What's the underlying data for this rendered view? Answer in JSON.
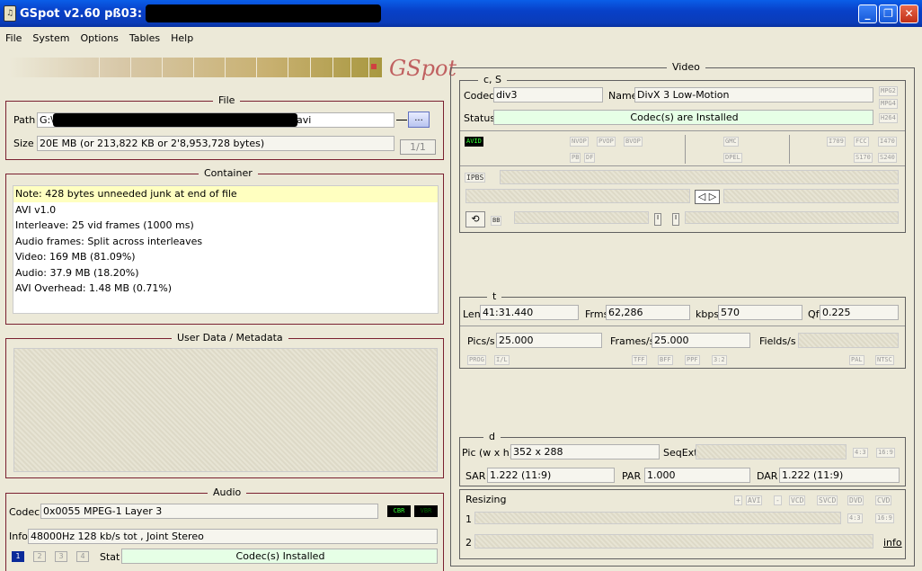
{
  "window": {
    "title": "GSpot v2.60 pß03:"
  },
  "menu": [
    "File",
    "System",
    "Options",
    "Tables",
    "Help"
  ],
  "logo": "GSpot",
  "file": {
    "title": "File",
    "path_label": "Path",
    "path_prefix": "G:\\",
    "path_suffix": "avi",
    "browse_label": "...",
    "size_label": "Size",
    "size_value": "20E MB (or 213,822 KB or 2'8,953,728 bytes)",
    "counter": "1/1"
  },
  "container": {
    "title": "Container",
    "lines": [
      "Note: 428 bytes unneeded junk at end of file",
      "AVI v1.0",
      "Interleave: 25 vid frames (1000 ms)",
      "Audio frames: Split across interleaves",
      "Video: 169 MB (81.09%)",
      "Audio: 37.9 MB (18.20%)",
      "AVI Overhead: 1.48 MB (0.71%)"
    ]
  },
  "userdata": {
    "title": "User Data / Metadata"
  },
  "audio": {
    "title": "Audio",
    "codec_label": "Codec",
    "codec_value": "0x0055 MPEG-1 Layer 3",
    "cbr": "CBR",
    "vbr": "VBR",
    "info_label": "Info",
    "info_value": "48000Hz  128 kb/s tot , Joint Stereo",
    "tracks": [
      "1",
      "2",
      "3",
      "4"
    ],
    "stat_label": "Stat",
    "stat_value": "Codec(s) Installed"
  },
  "video": {
    "title": "Video",
    "cs": {
      "title": "c, S",
      "codec_label": "Codec",
      "codec_value": "div3",
      "name_label": "Name",
      "name_value": "DivX 3 Low-Motion",
      "status_label": "Status",
      "status_value": "Codec(s) are Installed",
      "fmt_tags": [
        "MPG2",
        "MPG4",
        "H264"
      ],
      "avid": "AVID",
      "tags_row1": [
        "NVOP",
        "PVOP",
        "BVOP",
        "GMC",
        "I709",
        "FCC",
        "I470"
      ],
      "tags_row2": [
        "PB",
        "DF",
        "DPEL",
        "S170",
        "S240"
      ],
      "ipbs": "IPBS",
      "bb": "BB"
    },
    "t": {
      "title": "t",
      "len_label": "Len",
      "len_value": "41:31.440",
      "frms_label": "Frms",
      "frms_value": "62,286",
      "kbps_label": "kbps",
      "kbps_value": "570",
      "qf_label": "Qf",
      "qf_value": "0.225",
      "pics_label": "Pics/s",
      "pics_value": "25.000",
      "frames_label": "Frames/s",
      "frames_value": "25.000",
      "fields_label": "Fields/s",
      "tags": [
        "PROG",
        "I/L",
        "TFF",
        "BFF",
        "PPF",
        "3:2",
        "PAL",
        "NTSC"
      ]
    },
    "d": {
      "title": "d",
      "pic_label": "Pic (w x h)",
      "pic_value": "352 x 288",
      "seqext_label": "SeqExt",
      "aspect_tags": [
        "4:3",
        "16:9"
      ],
      "sar_label": "SAR",
      "sar_value": "1.222 (11:9)",
      "par_label": "PAR",
      "par_value": "1.000",
      "dar_label": "DAR",
      "dar_value": "1.222 (11:9)"
    },
    "resizing": {
      "title": "Resizing",
      "buttons": [
        "+",
        "AVI",
        "-",
        "VCD",
        "SVCD",
        "DVD",
        "CVD"
      ],
      "row1_label": "1",
      "row2_label": "2",
      "aspect_tags": [
        "4:3",
        "16:9"
      ],
      "info_link": "info"
    }
  }
}
